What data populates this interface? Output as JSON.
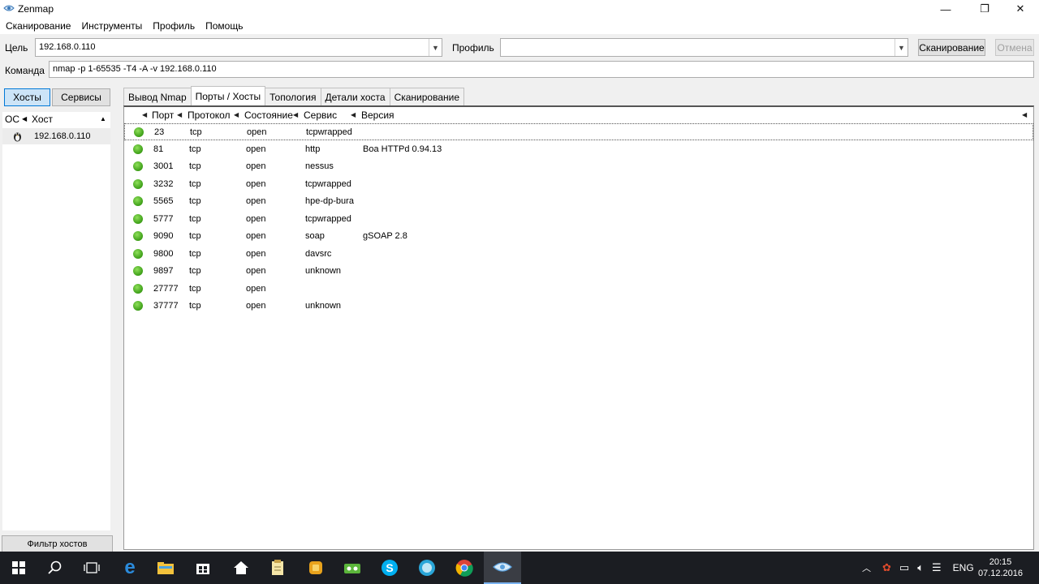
{
  "window": {
    "title": "Zenmap",
    "minimize": "—",
    "maximize": "❐",
    "close": "✕"
  },
  "menu": [
    "Сканирование",
    "Инструменты",
    "Профиль",
    "Помощь"
  ],
  "toolbar": {
    "target_label": "Цель",
    "target_value": "192.168.0.110",
    "profile_label": "Профиль",
    "profile_value": "",
    "scan_button": "Сканирование",
    "cancel_button": "Отмена",
    "command_label": "Команда",
    "command_value": "nmap -p 1-65535 -T4 -A -v 192.168.0.110"
  },
  "left": {
    "hosts_button": "Хосты",
    "services_button": "Сервисы",
    "col_os": "ОС",
    "col_host": "Хост",
    "hosts": [
      {
        "ip": "192.168.0.110"
      }
    ],
    "filter_button": "Фильтр хостов"
  },
  "tabs": [
    "Вывод Nmap",
    "Порты / Хосты",
    "Топология",
    "Детали хоста",
    "Сканирование"
  ],
  "active_tab": "Порты / Хосты",
  "columns": {
    "port": "Порт",
    "protocol": "Протокол",
    "state": "Состояние",
    "service": "Сервис",
    "version": "Версия"
  },
  "ports": [
    {
      "port": "23",
      "protocol": "tcp",
      "state": "open",
      "service": "tcpwrapped",
      "version": ""
    },
    {
      "port": "81",
      "protocol": "tcp",
      "state": "open",
      "service": "http",
      "version": "Boa HTTPd 0.94.13"
    },
    {
      "port": "3001",
      "protocol": "tcp",
      "state": "open",
      "service": "nessus",
      "version": ""
    },
    {
      "port": "3232",
      "protocol": "tcp",
      "state": "open",
      "service": "tcpwrapped",
      "version": ""
    },
    {
      "port": "5565",
      "protocol": "tcp",
      "state": "open",
      "service": "hpe-dp-bura",
      "version": ""
    },
    {
      "port": "5777",
      "protocol": "tcp",
      "state": "open",
      "service": "tcpwrapped",
      "version": ""
    },
    {
      "port": "9090",
      "protocol": "tcp",
      "state": "open",
      "service": "soap",
      "version": "gSOAP 2.8"
    },
    {
      "port": "9800",
      "protocol": "tcp",
      "state": "open",
      "service": "davsrc",
      "version": ""
    },
    {
      "port": "9897",
      "protocol": "tcp",
      "state": "open",
      "service": "unknown",
      "version": ""
    },
    {
      "port": "27777",
      "protocol": "tcp",
      "state": "open",
      "service": "",
      "version": ""
    },
    {
      "port": "37777",
      "protocol": "tcp",
      "state": "open",
      "service": "unknown",
      "version": ""
    }
  ],
  "port_status_color": "#3c9e17",
  "taskbar": {
    "icons": [
      "start-icon",
      "search-icon",
      "task-view-icon",
      "edge-icon",
      "file-explorer-icon",
      "store-icon",
      "home-icon",
      "notes-icon",
      "app-yellow-icon",
      "app-green-icon",
      "skype-icon",
      "app-blue-icon",
      "chrome-icon",
      "zenmap-icon"
    ],
    "lang": "ENG",
    "time": "20:15",
    "date": "07.12.2016"
  }
}
